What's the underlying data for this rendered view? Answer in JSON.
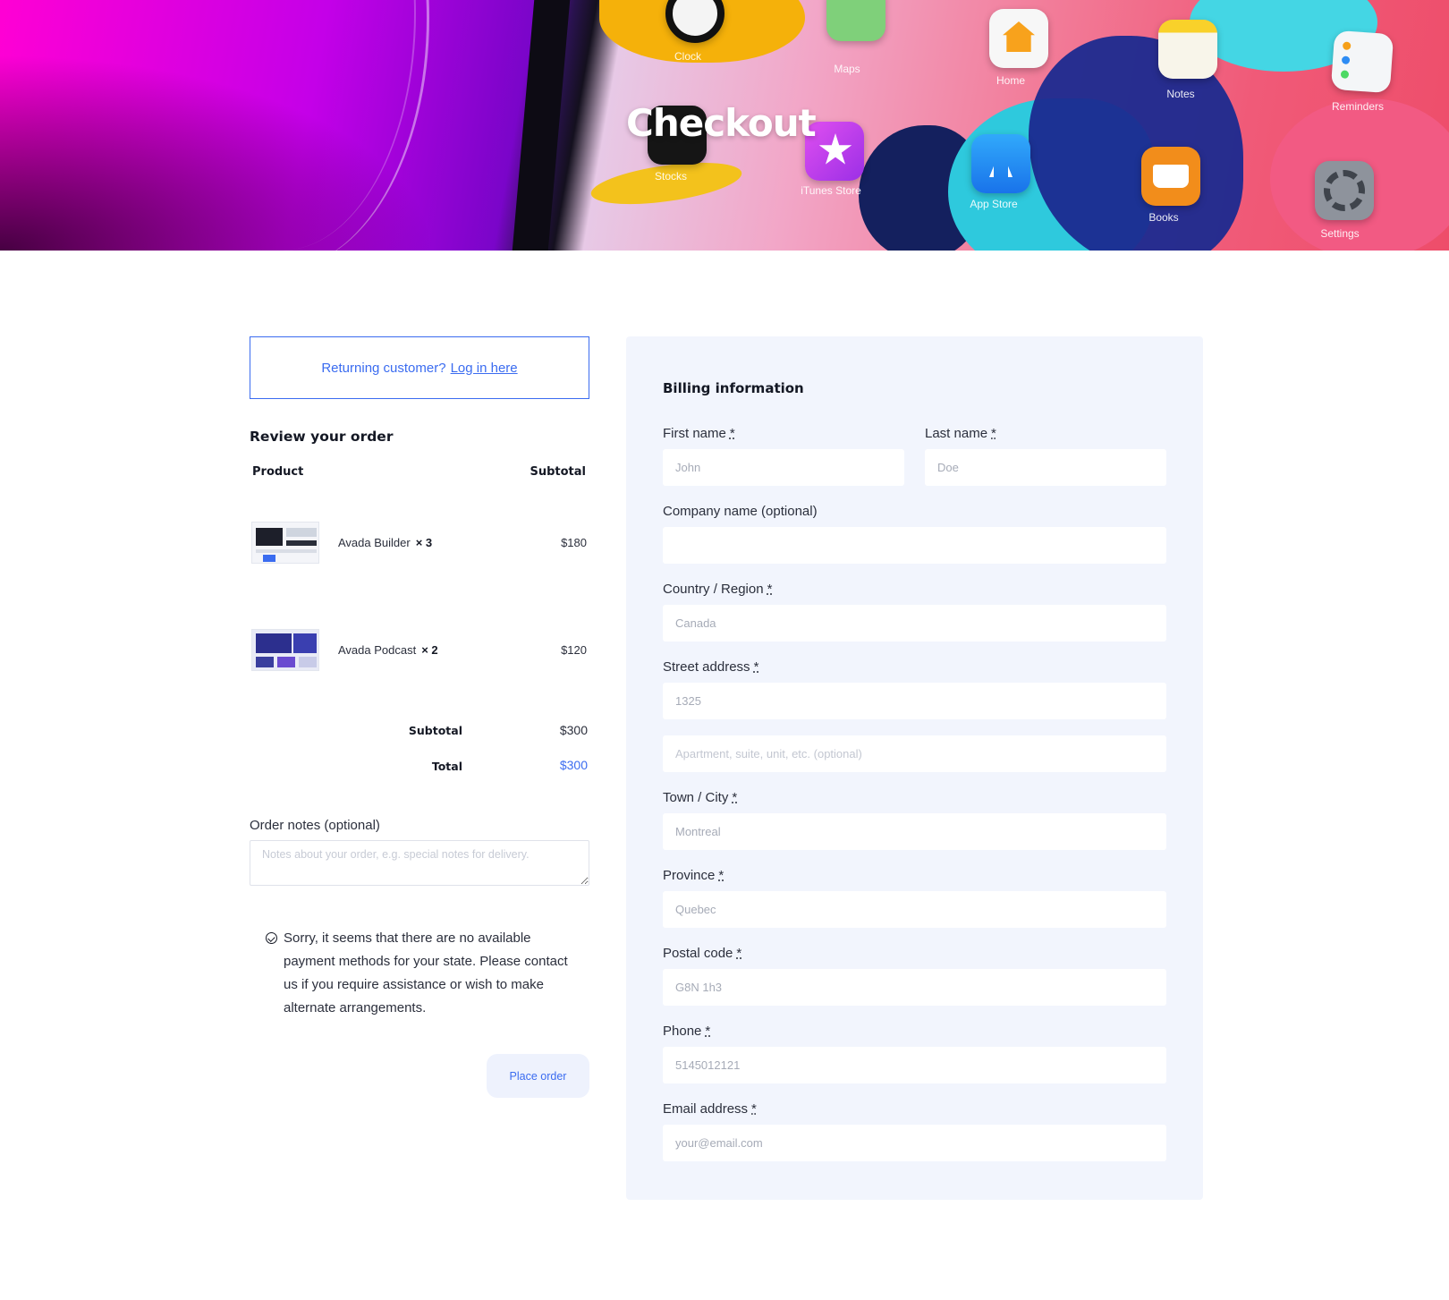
{
  "hero": {
    "title": "Checkout",
    "apps": [
      {
        "name": "Clock",
        "color": "#111111"
      },
      {
        "name": "Maps",
        "color": "#7fd07a"
      },
      {
        "name": "Home",
        "color": "#f8a21c"
      },
      {
        "name": "Notes",
        "color": "#f6f3e8"
      },
      {
        "name": "Reminders",
        "color": "#f4f6f8"
      },
      {
        "name": "Stocks",
        "color": "#1a1a1a"
      },
      {
        "name": "iTunes Store",
        "color": "#c53ae6"
      },
      {
        "name": "App Store",
        "color": "#2d8cf4"
      },
      {
        "name": "Books",
        "color": "#f28d1b"
      },
      {
        "name": "Settings",
        "color": "#8e939c"
      }
    ]
  },
  "returning": {
    "prompt": "Returning customer?",
    "link": "Log in here"
  },
  "review": {
    "title": "Review your order",
    "col_product": "Product",
    "col_subtotal": "Subtotal",
    "items": [
      {
        "name": "Avada Builder",
        "qty": "× 3",
        "price": "$180",
        "thumb": "builder-thumbnail"
      },
      {
        "name": "Avada Podcast",
        "qty": "× 2",
        "price": "$120",
        "thumb": "podcast-thumbnail"
      }
    ],
    "subtotal_label": "Subtotal",
    "subtotal_value": "$300",
    "total_label": "Total",
    "total_value": "$300"
  },
  "notes": {
    "label": "Order notes (optional)",
    "placeholder": "Notes about your order, e.g. special notes for delivery."
  },
  "payment_notice": "Sorry, it seems that there are no available payment methods for your state. Please contact us if you require assistance or wish to make alternate arrangements.",
  "place_order": "Place order",
  "billing": {
    "title": "Billing information",
    "required_mark": "*",
    "first_name": {
      "label": "First name",
      "value": "John"
    },
    "last_name": {
      "label": "Last name",
      "value": "Doe"
    },
    "company": {
      "label": "Company name (optional)",
      "value": ""
    },
    "country": {
      "label": "Country / Region",
      "value": "Canada"
    },
    "street": {
      "label": "Street address",
      "value": "1325",
      "placeholder2": "Apartment, suite, unit, etc. (optional)"
    },
    "city": {
      "label": "Town / City",
      "value": "Montreal"
    },
    "province": {
      "label": "Province",
      "value": "Quebec"
    },
    "postal": {
      "label": "Postal code",
      "value": "G8N 1h3"
    },
    "phone": {
      "label": "Phone",
      "value": "5145012121"
    },
    "email": {
      "label": "Email address",
      "value": "your@email.com"
    }
  },
  "colors": {
    "accent": "#3b6cf0",
    "panel": "#f2f5fd",
    "text": "#2b2f3c"
  }
}
